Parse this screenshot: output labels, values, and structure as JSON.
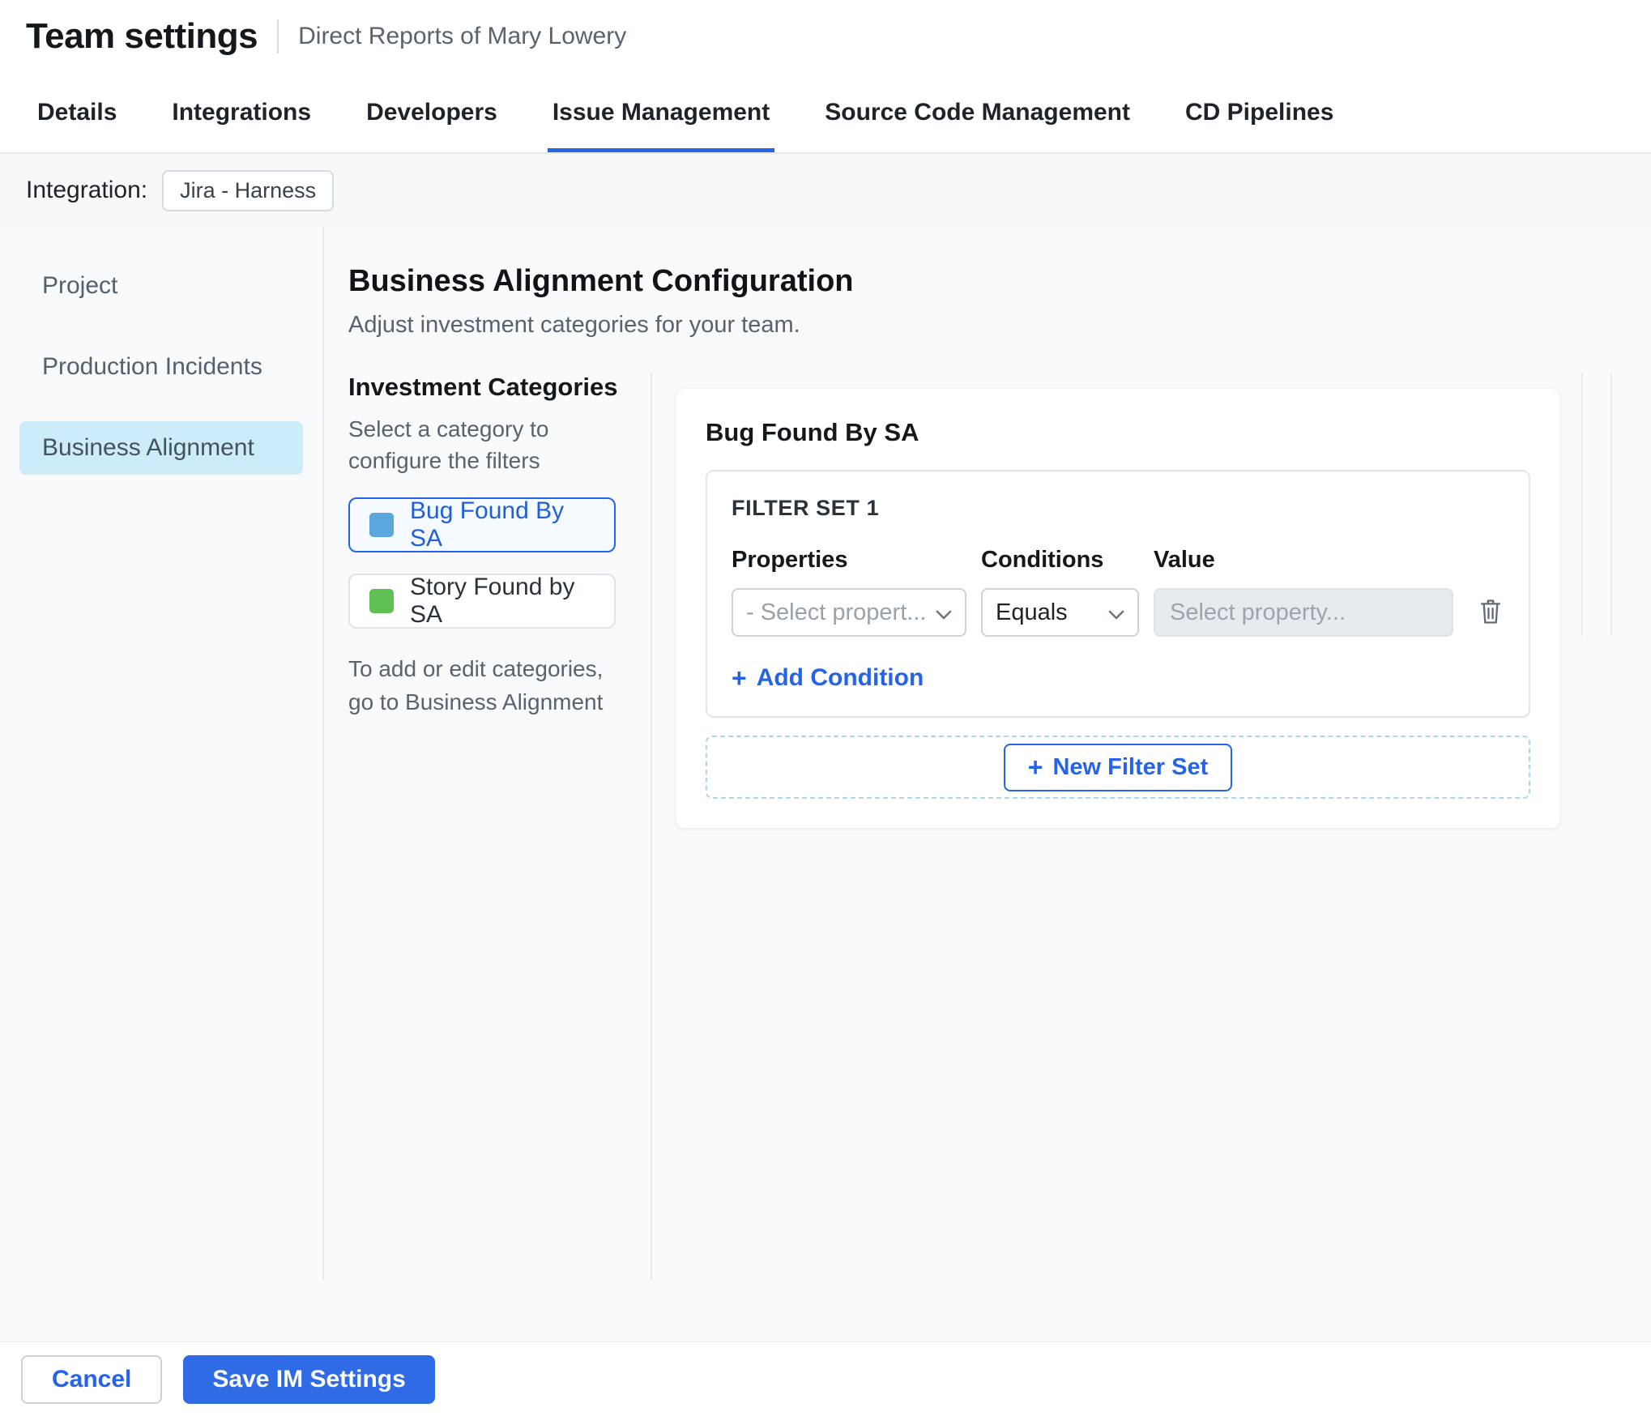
{
  "header": {
    "title": "Team settings",
    "subtitle": "Direct Reports of Mary Lowery"
  },
  "tabs": [
    {
      "label": "Details"
    },
    {
      "label": "Integrations"
    },
    {
      "label": "Developers"
    },
    {
      "label": "Issue Management"
    },
    {
      "label": "Source Code Management"
    },
    {
      "label": "CD Pipelines"
    }
  ],
  "active_tab": "Issue Management",
  "integration": {
    "label": "Integration:",
    "value": "Jira - Harness"
  },
  "sidebar": {
    "items": [
      {
        "label": "Project"
      },
      {
        "label": "Production Incidents"
      },
      {
        "label": "Business Alignment"
      }
    ],
    "active": "Business Alignment"
  },
  "main": {
    "title": "Business Alignment Configuration",
    "subtitle": "Adjust investment categories for your team.",
    "categories": {
      "heading": "Investment Categories",
      "hint": "Select a category to configure the filters",
      "items": [
        {
          "label": "Bug Found By SA",
          "swatch_color": "#5aa7dd",
          "selected": true
        },
        {
          "label": "Story Found by SA",
          "swatch_color": "#5fc153",
          "selected": false
        }
      ],
      "selected": "Bug Found By SA",
      "note": "To add or edit categories, go to Business Alignment"
    },
    "panel": {
      "title": "Bug Found By SA",
      "filter_set": {
        "label": "FILTER SET 1",
        "headers": {
          "properties": "Properties",
          "conditions": "Conditions",
          "value": "Value"
        },
        "property_select": "- Select propert...",
        "condition_select": "Equals",
        "value_placeholder": "Select property...",
        "add_condition": "Add Condition"
      },
      "new_filter_set": "New Filter Set"
    }
  },
  "footer": {
    "cancel": "Cancel",
    "save": "Save IM Settings"
  },
  "icons": {
    "plus": "+"
  },
  "colors": {
    "accent": "#2563eb",
    "selected_nav_bg": "#cdecfa"
  }
}
